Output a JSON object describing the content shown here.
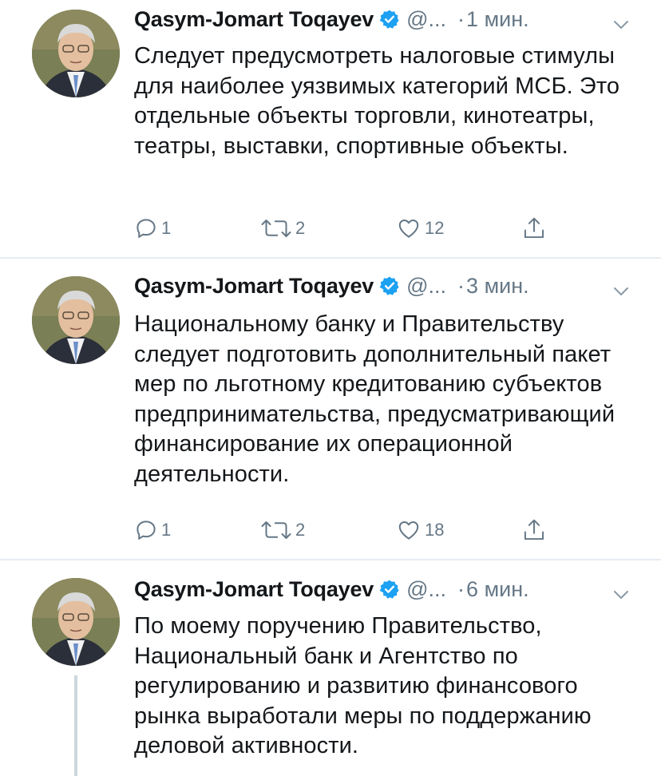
{
  "tweets": [
    {
      "name": "Qasym-Jomart Toqayev",
      "handle": "@...",
      "time": "1 мин.",
      "text": "Следует предусмотреть налоговые стимулы для наиболее уязвимых категорий МСБ. Это отдельные объекты торговли, кинотеатры, театры, выставки, спортивные объекты.",
      "replies": "1",
      "retweets": "2",
      "likes": "12"
    },
    {
      "name": "Qasym-Jomart Toqayev",
      "handle": "@...",
      "time": "3 мин.",
      "text": "Национальному банку и Правительству следует подготовить дополнительный пакет мер по льготному кредитованию субъектов предпринимательства, предусматривающий финансирование их операционной деятельности.",
      "replies": "1",
      "retweets": "2",
      "likes": "18"
    },
    {
      "name": "Qasym-Jomart Toqayev",
      "handle": "@...",
      "time": "6 мин.",
      "text": "По моему поручению Правительство, Национальный банк и Агентство по регулированию и развитию финансового рынка выработали меры по поддержанию деловой активности."
    }
  ],
  "colors": {
    "verified": "#1da1f2",
    "secondary_text": "#657786",
    "divider": "#e6ecf0",
    "thread_line": "#ccd6dd"
  },
  "icons": [
    "reply-icon",
    "retweet-icon",
    "like-icon",
    "share-icon",
    "verified-badge-icon",
    "chevron-down-icon"
  ]
}
